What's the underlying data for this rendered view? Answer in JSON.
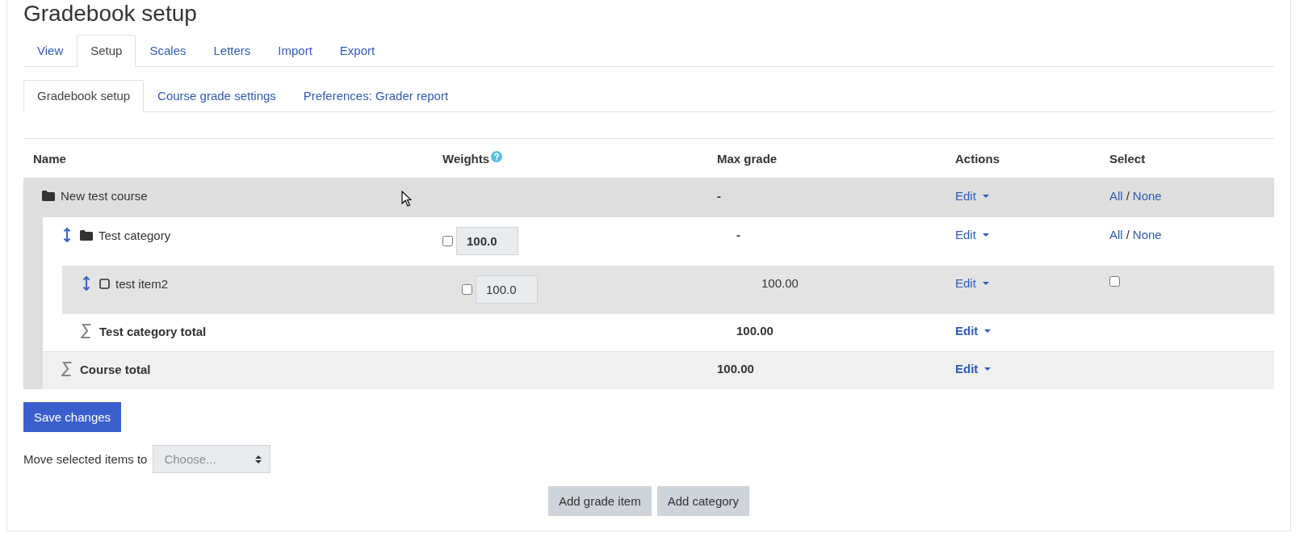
{
  "page_title": "Gradebook setup",
  "tabs": [
    {
      "label": "View",
      "selected": false
    },
    {
      "label": "Setup",
      "selected": true
    },
    {
      "label": "Scales",
      "selected": false
    },
    {
      "label": "Letters",
      "selected": false
    },
    {
      "label": "Import",
      "selected": false
    },
    {
      "label": "Export",
      "selected": false
    }
  ],
  "subtabs": [
    {
      "label": "Gradebook setup",
      "selected": true
    },
    {
      "label": "Course grade settings",
      "selected": false
    },
    {
      "label": "Preferences: Grader report",
      "selected": false
    }
  ],
  "table": {
    "columns": [
      "Name",
      "Weights",
      "Max grade",
      "Actions",
      "Select"
    ],
    "course": {
      "name": "New test course",
      "max_grade": "-",
      "action": "Edit",
      "select_all": "All",
      "select_separator": "/",
      "select_none": "None",
      "children": [
        {
          "kind": "category",
          "name": "Test category",
          "weight": "100.0",
          "weight_checked": false,
          "max_grade": "-",
          "action": "Edit",
          "select_all": "All",
          "select_separator": "/",
          "select_none": "None",
          "children": [
            {
              "kind": "item",
              "name": "test item2",
              "weight": "100.0",
              "weight_checked": false,
              "max_grade": "100.00",
              "action": "Edit",
              "selected": false
            }
          ],
          "total": {
            "name": "Test category total",
            "max_grade": "100.00",
            "action": "Edit"
          }
        }
      ],
      "total": {
        "name": "Course total",
        "max_grade": "100.00",
        "action": "Edit"
      }
    }
  },
  "save_button": "Save changes",
  "move": {
    "label": "Move selected items to",
    "value": "Choose..."
  },
  "buttons": [
    "Add grade item",
    "Add category"
  ]
}
